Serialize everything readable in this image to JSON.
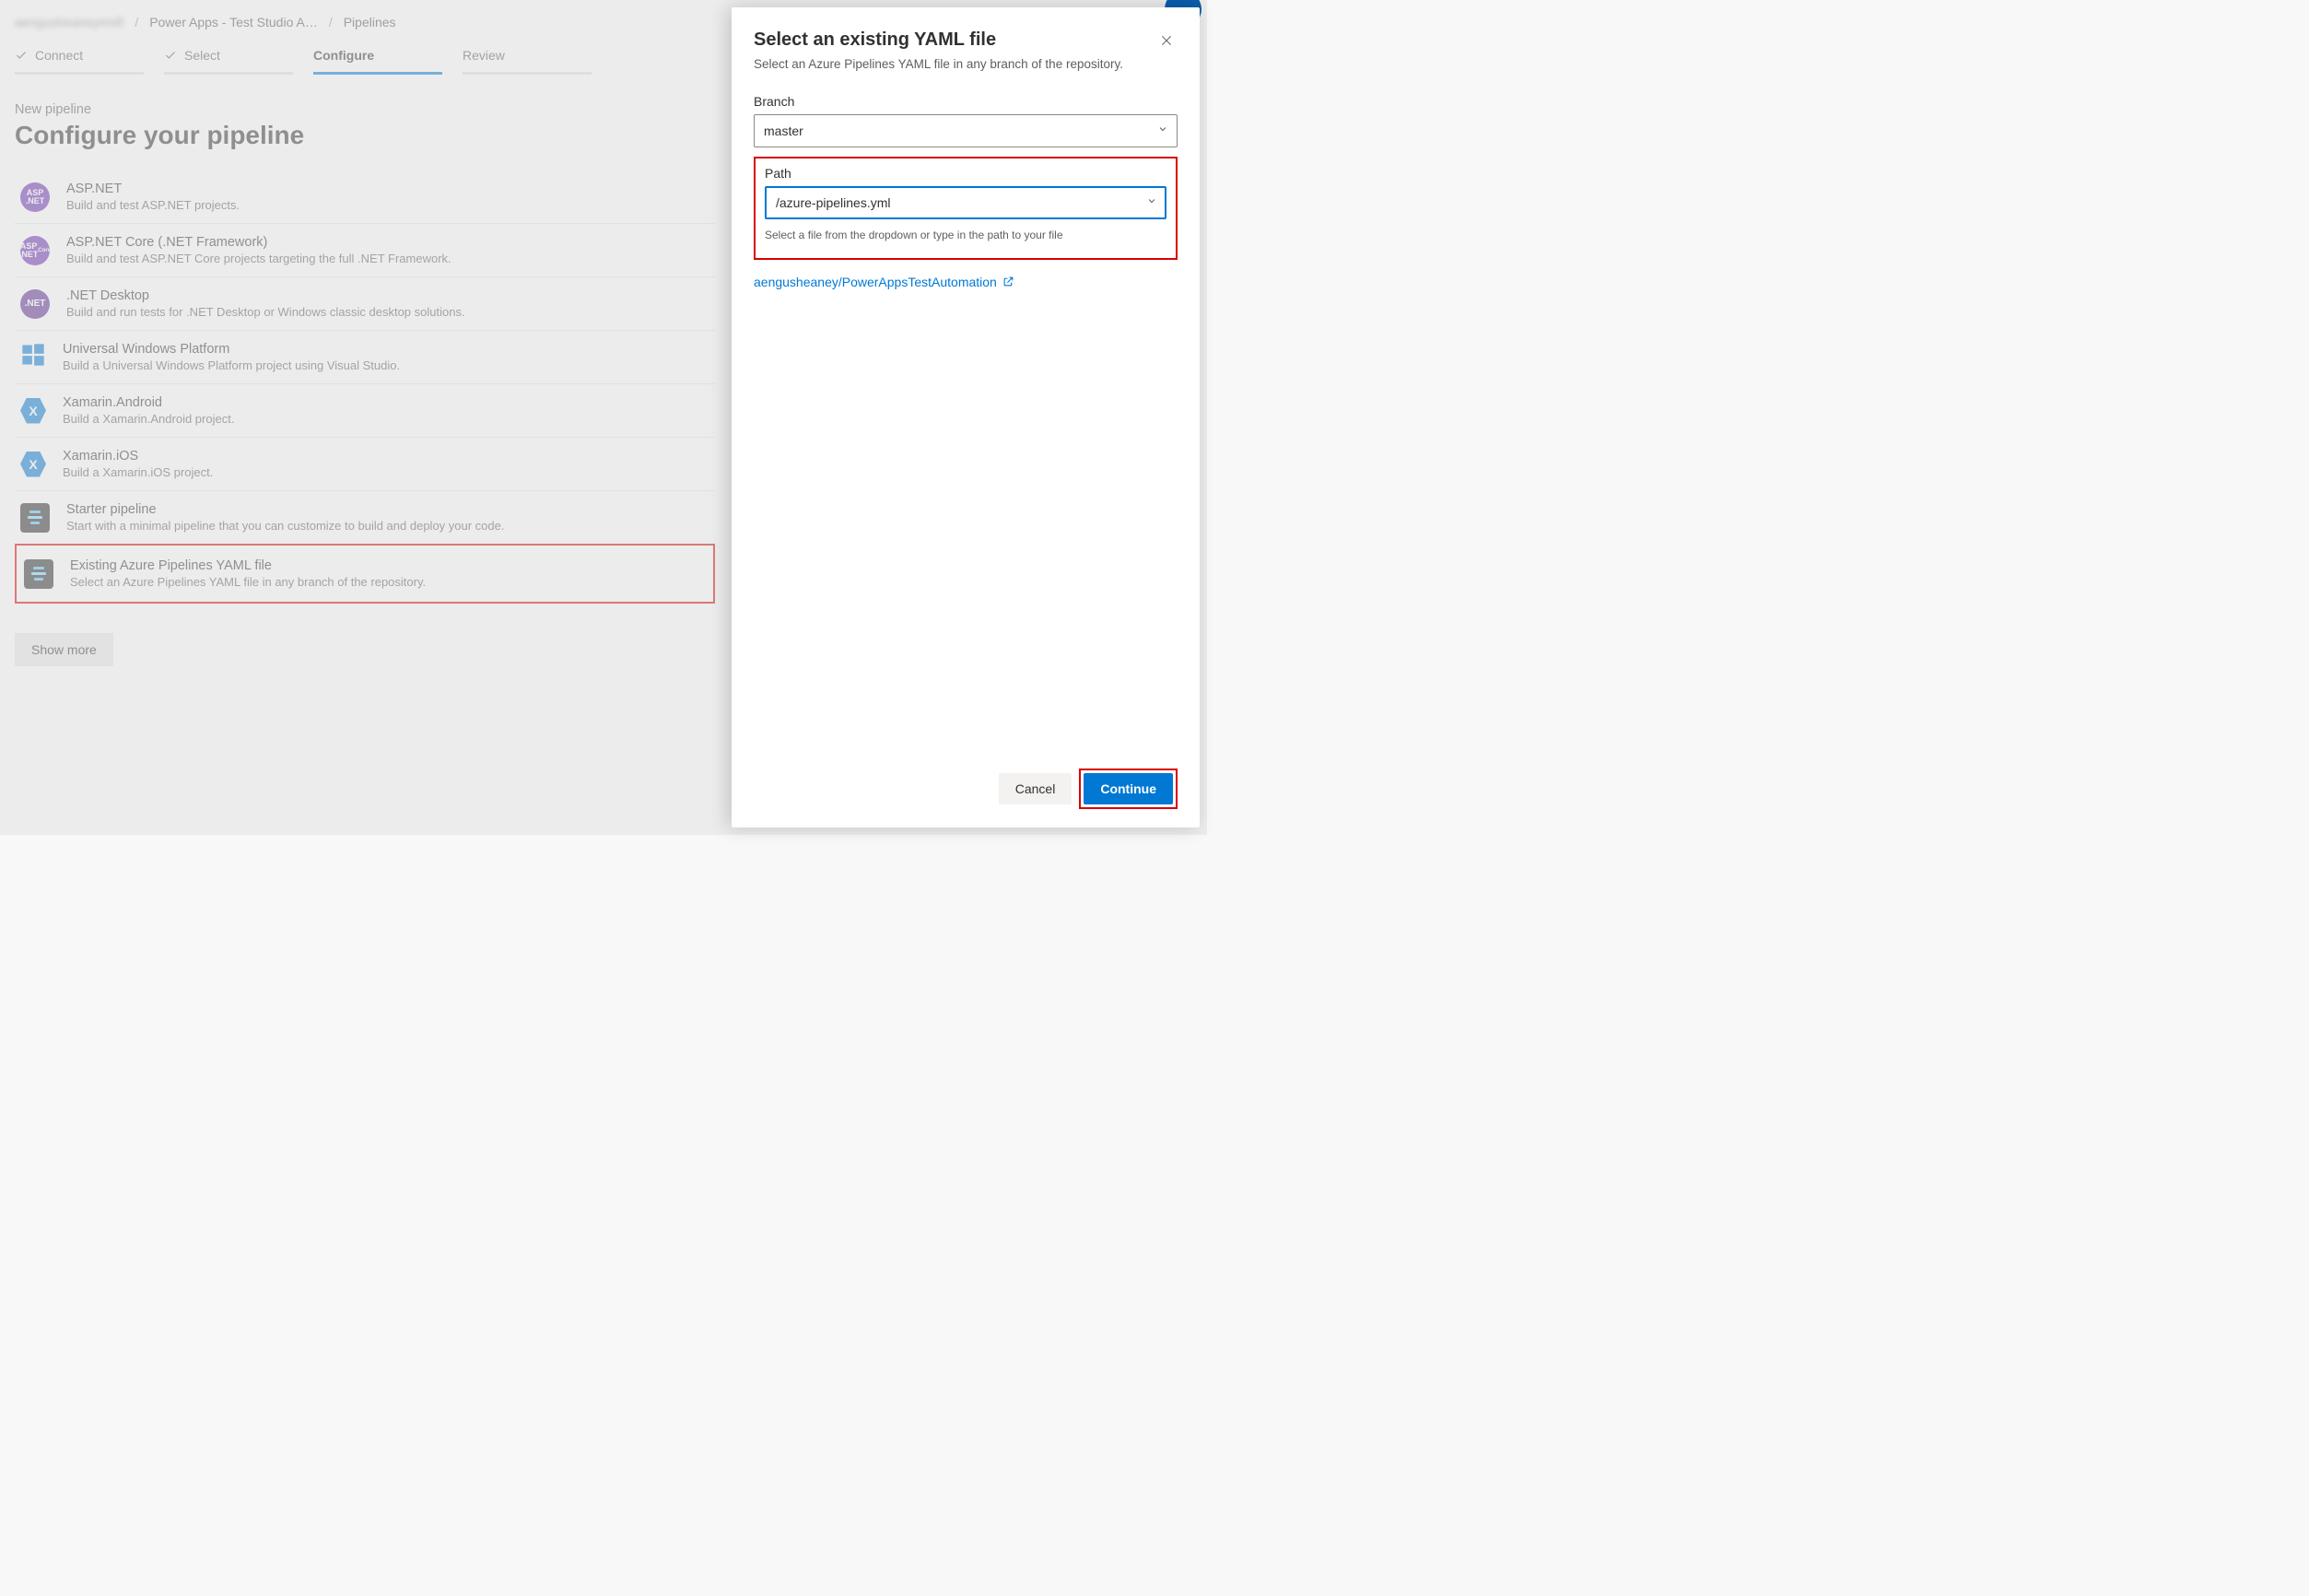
{
  "breadcrumb": {
    "org": "aengusheaneymsft",
    "project": "Power Apps - Test Studio A…",
    "page": "Pipelines"
  },
  "steps": {
    "connect": "Connect",
    "select": "Select",
    "configure": "Configure",
    "review": "Review"
  },
  "header": {
    "sub": "New pipeline",
    "title": "Configure your pipeline"
  },
  "options": [
    {
      "title": "ASP.NET",
      "desc": "Build and test ASP.NET projects.",
      "icon": "aspnet"
    },
    {
      "title": "ASP.NET Core (.NET Framework)",
      "desc": "Build and test ASP.NET Core projects targeting the full .NET Framework.",
      "icon": "aspnetcore"
    },
    {
      "title": ".NET Desktop",
      "desc": "Build and run tests for .NET Desktop or Windows classic desktop solutions.",
      "icon": "netdesktop"
    },
    {
      "title": "Universal Windows Platform",
      "desc": "Build a Universal Windows Platform project using Visual Studio.",
      "icon": "uwp"
    },
    {
      "title": "Xamarin.Android",
      "desc": "Build a Xamarin.Android project.",
      "icon": "xamarin"
    },
    {
      "title": "Xamarin.iOS",
      "desc": "Build a Xamarin.iOS project.",
      "icon": "xamarin"
    },
    {
      "title": "Starter pipeline",
      "desc": "Start with a minimal pipeline that you can customize to build and deploy your code.",
      "icon": "yaml"
    },
    {
      "title": "Existing Azure Pipelines YAML file",
      "desc": "Select an Azure Pipelines YAML file in any branch of the repository.",
      "icon": "yaml"
    }
  ],
  "show_more": "Show more",
  "panel": {
    "title": "Select an existing YAML file",
    "desc": "Select an Azure Pipelines YAML file in any branch of the repository.",
    "branch_label": "Branch",
    "branch_value": "master",
    "path_label": "Path",
    "path_value": "/azure-pipelines.yml",
    "path_helper": "Select a file from the dropdown or type in the path to your file",
    "repo_link": "aengusheaney/PowerAppsTestAutomation",
    "cancel": "Cancel",
    "continue": "Continue"
  }
}
